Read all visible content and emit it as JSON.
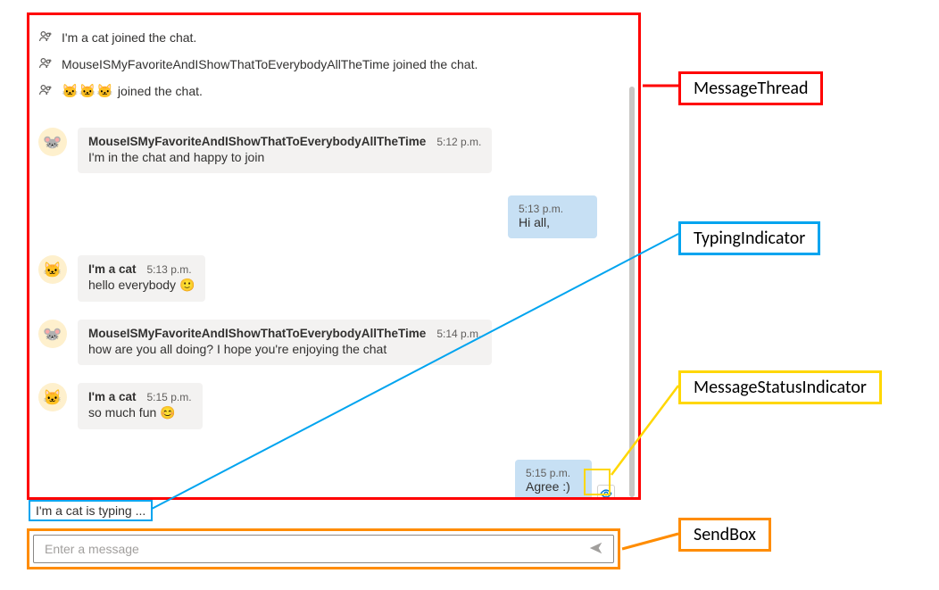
{
  "system_joins": [
    {
      "text": "I'm a cat joined the chat."
    },
    {
      "text": "MouseISMyFavoriteAndIShowThatToEverybodyAllTheTime joined the chat."
    },
    {
      "text_prefix_emoji": "🐱🐱🐱",
      "text": " joined the chat."
    }
  ],
  "messages": [
    {
      "id": "m1",
      "avatar_emoji": "🐭",
      "sender": "MouseISMyFavoriteAndIShowThatToEverybodyAllTheTime",
      "time": "5:12 p.m.",
      "text": "I'm in the chat and happy to join"
    },
    {
      "id": "m2",
      "mine": true,
      "time": "5:13 p.m.",
      "text": "Hi all,"
    },
    {
      "id": "m3",
      "avatar_emoji": "🐱",
      "sender": "I'm a cat",
      "time": "5:13 p.m.",
      "text": "hello everybody 🙂"
    },
    {
      "id": "m4",
      "avatar_emoji": "🐭",
      "sender": "MouseISMyFavoriteAndIShowThatToEverybodyAllTheTime",
      "time": "5:14 p.m.",
      "text": "how are you all doing? I hope you're enjoying the chat"
    },
    {
      "id": "m5",
      "avatar_emoji": "🐱",
      "sender": "I'm a cat",
      "time": "5:15 p.m.",
      "text": "so much fun 😊"
    },
    {
      "id": "m6",
      "mine": true,
      "time": "5:15 p.m.",
      "text": "Agree :)",
      "status": "seen"
    }
  ],
  "typing": {
    "text": "I'm a cat is typing ..."
  },
  "sendbox": {
    "placeholder": "Enter a message"
  },
  "labels": {
    "thread": "MessageThread",
    "typing": "TypingIndicator",
    "status": "MessageStatusIndicator",
    "sendbox": "SendBox"
  },
  "icons": {
    "people_add": "people-add-icon",
    "seen": "seen-eye-icon",
    "send": "send-icon"
  }
}
